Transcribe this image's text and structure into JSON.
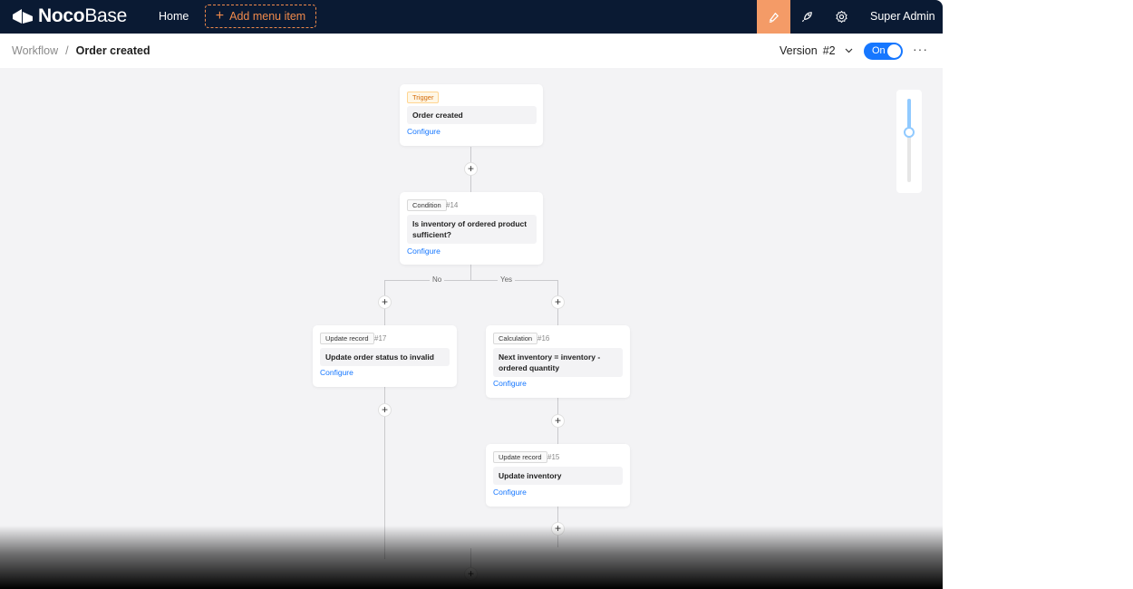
{
  "topbar": {
    "logo_bold": "Noco",
    "logo_light": "Base",
    "home": "Home",
    "add_menu": "Add menu item",
    "user": "Super Admin"
  },
  "header": {
    "breadcrumb_root": "Workflow",
    "breadcrumb_sep": "/",
    "breadcrumb_current": "Order created",
    "version_label": "Version",
    "version_value": "#2",
    "toggle_label": "On",
    "more": "···"
  },
  "zoom": {
    "level": 0.6
  },
  "branches": {
    "no": "No",
    "yes": "Yes"
  },
  "nodes": {
    "trigger": {
      "tag": "Trigger",
      "title": "Order created",
      "action": "Configure"
    },
    "condition": {
      "tag": "Condition",
      "id": "#14",
      "title": "Is inventory of ordered product sufficient?",
      "action": "Configure"
    },
    "update_status": {
      "tag": "Update record",
      "id": "#17",
      "title": "Update order status to invalid",
      "action": "Configure"
    },
    "calculation": {
      "tag": "Calculation",
      "id": "#16",
      "title": "Next inventory = inventory - ordered quantity",
      "action": "Configure"
    },
    "update_inventory": {
      "tag": "Update record",
      "id": "#15",
      "title": "Update inventory",
      "action": "Configure"
    }
  },
  "colors": {
    "nav_bg": "#0a1a33",
    "accent": "#f49b67",
    "primary": "#1677ff"
  }
}
